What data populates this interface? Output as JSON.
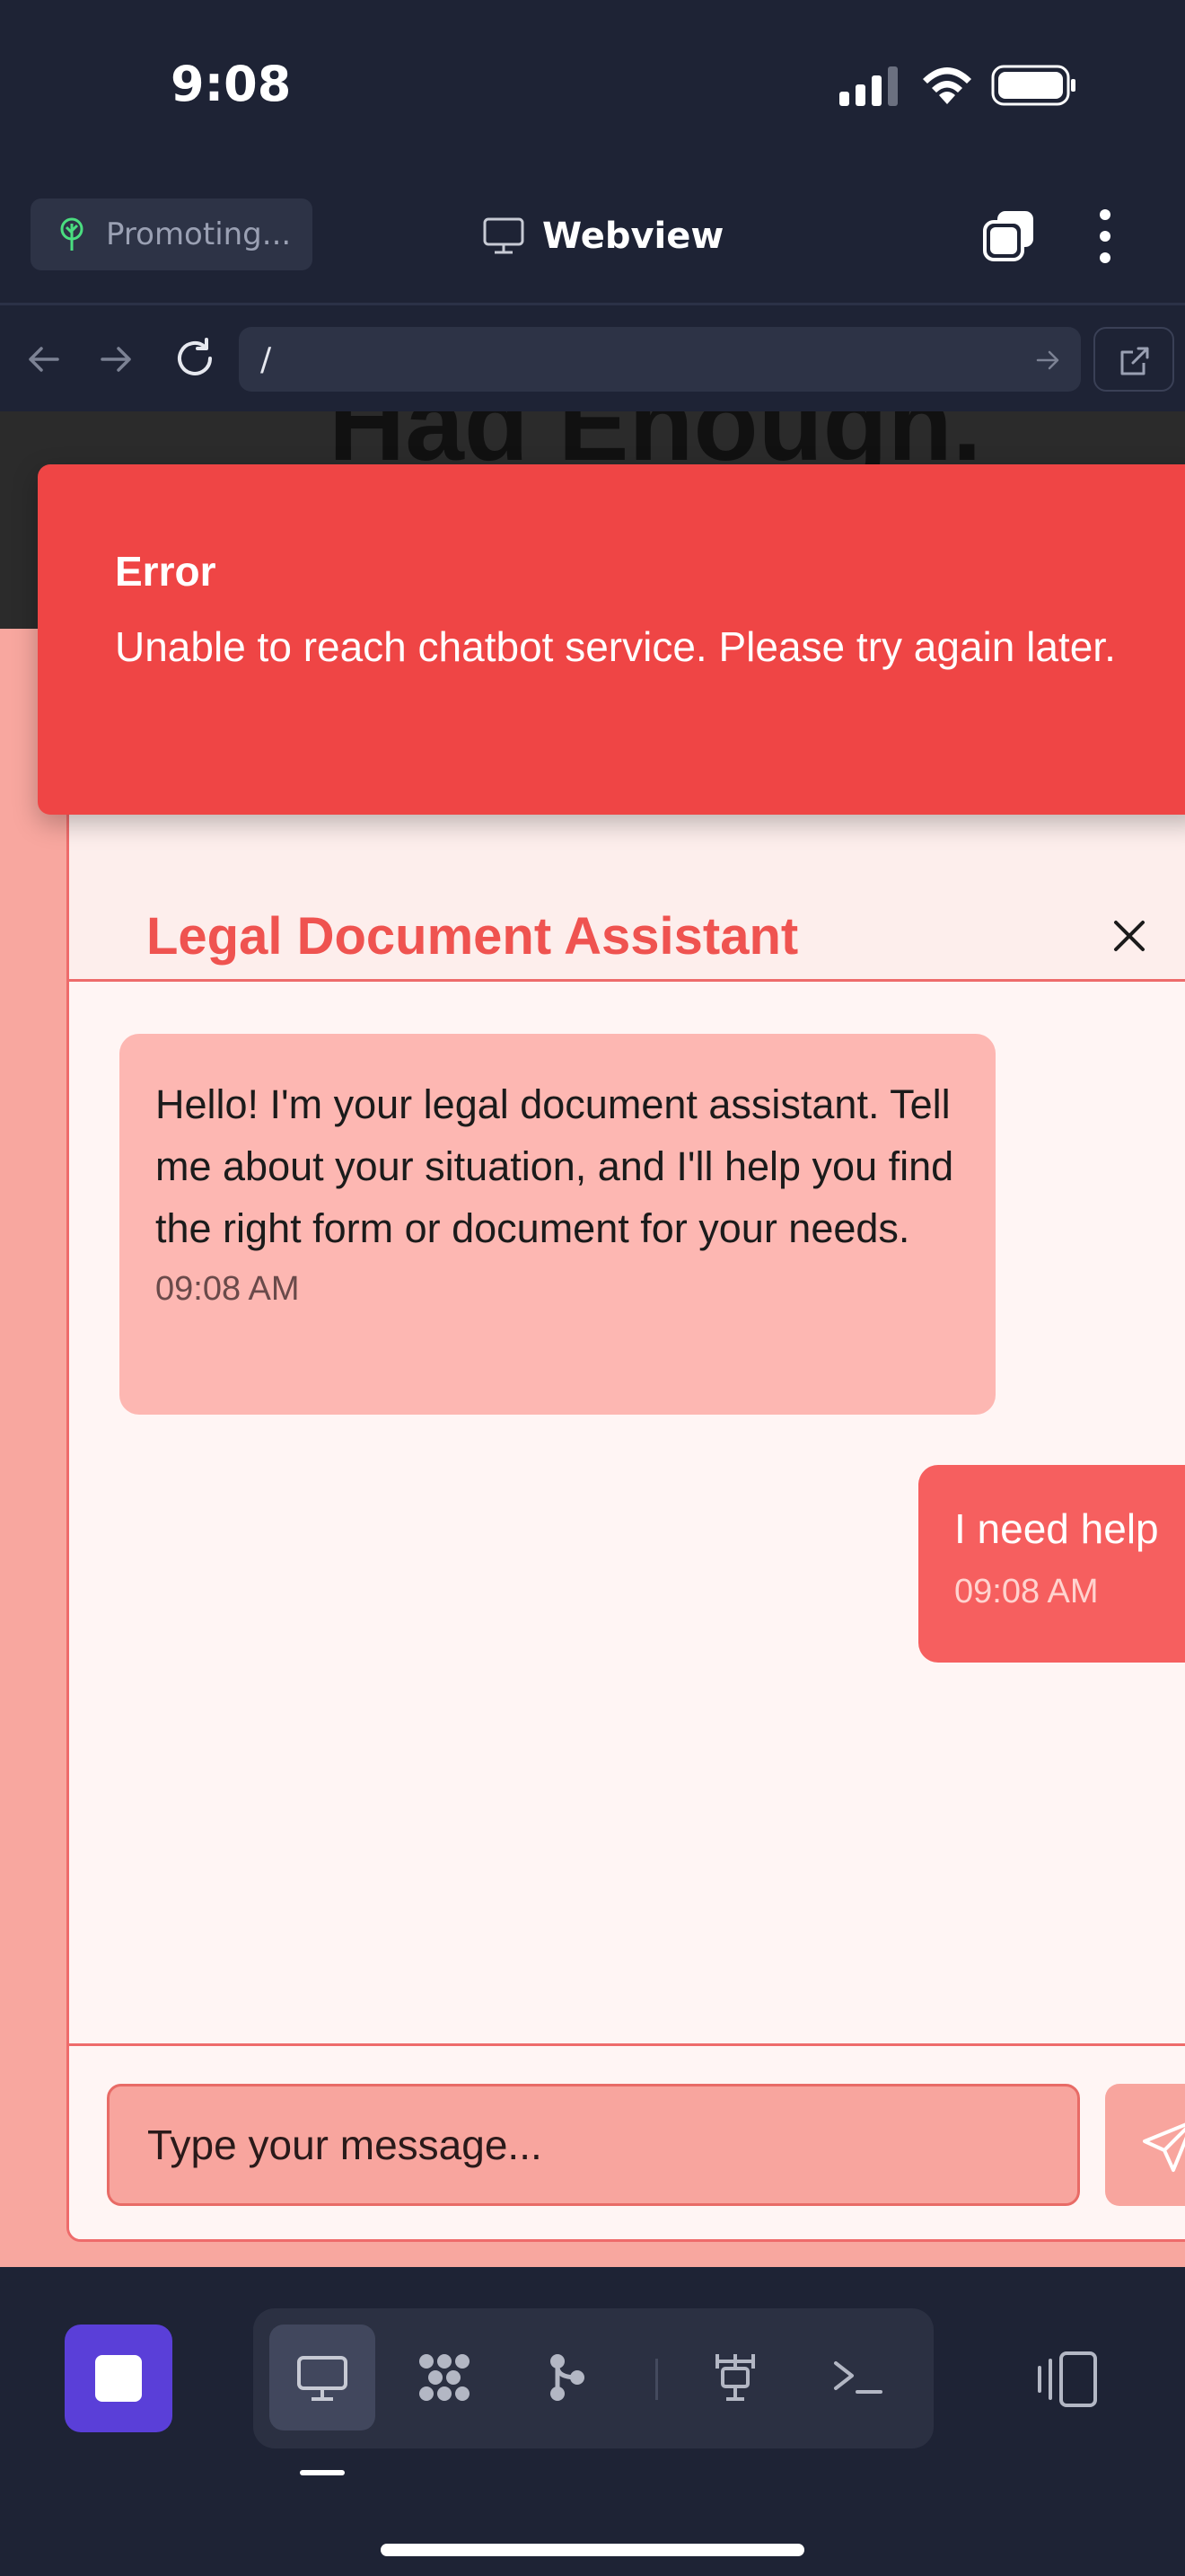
{
  "status_bar": {
    "time": "9:08"
  },
  "header": {
    "project_chip": "Promoting...",
    "title": "Webview"
  },
  "url_bar": {
    "url": "/"
  },
  "webview": {
    "hero_text": "Had Enough."
  },
  "error_toast": {
    "title": "Error",
    "message": "Unable to reach chatbot service. Please try again later."
  },
  "chat": {
    "title": "Legal Document Assistant",
    "messages": [
      {
        "sender": "bot",
        "text": "Hello! I'm your legal document assistant. Tell me about your situation, and I'll help you find the right form or document for your needs.",
        "time": "09:08 AM"
      },
      {
        "sender": "user",
        "text": "I need help",
        "time": "09:08 AM"
      }
    ],
    "input_placeholder": "Type your message..."
  },
  "toolbar": {
    "tools": [
      "monitor-icon",
      "extensions-icon",
      "git-branch-icon",
      "network-icon",
      "terminal-icon"
    ],
    "active_tool": "monitor-icon"
  },
  "colors": {
    "accent_error": "#ef4545",
    "chat_accent": "#ef5350",
    "stop_button": "#5a3fd8",
    "background_dark": "#1e2335"
  }
}
